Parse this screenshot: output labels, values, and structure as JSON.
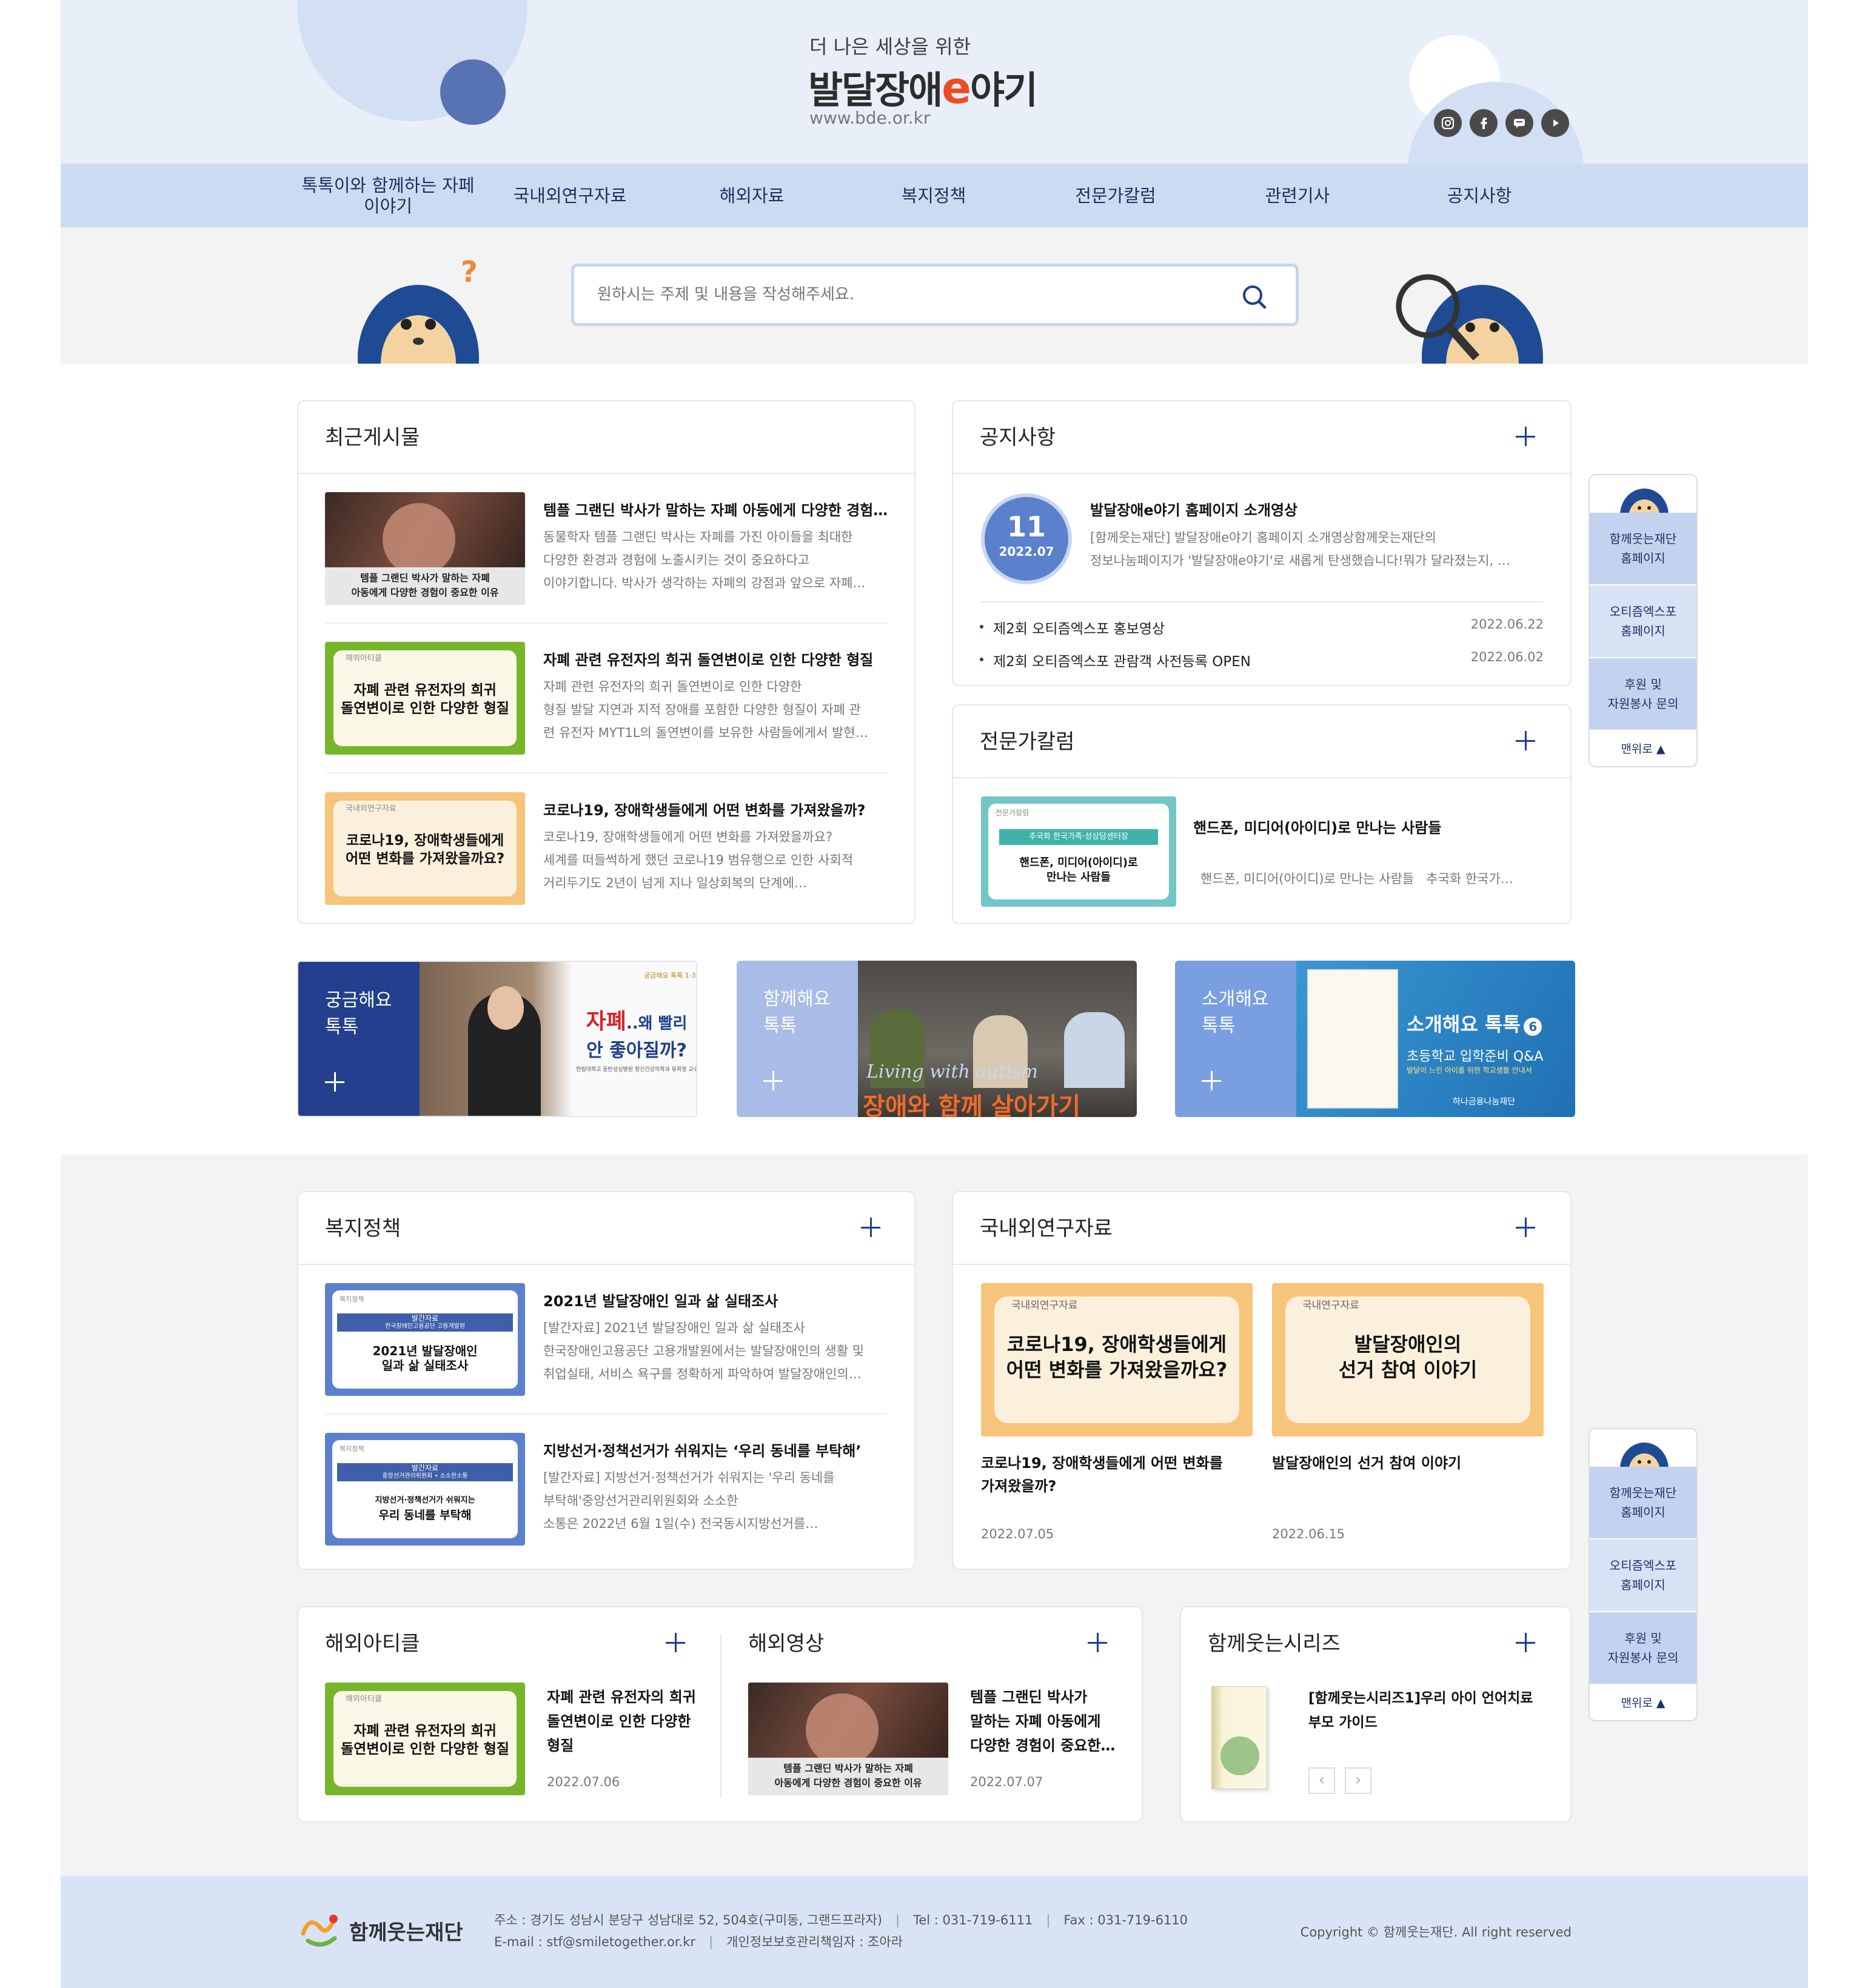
{
  "header": {
    "tagline": "더 나은 세상을 위한",
    "logo_a": "발달장애",
    "logo_e": "e",
    "logo_b": "야기",
    "url": "www.bde.or.kr"
  },
  "social": [
    "instagram-icon",
    "facebook-icon",
    "chat-icon",
    "youtube-icon"
  ],
  "nav": [
    "톡톡이와 함께하는 자페이야기",
    "국내외연구자료",
    "해외자료",
    "복지정책",
    "전문가칼럼",
    "관련기사",
    "공지사항"
  ],
  "search": {
    "placeholder": "원하시는 주제 및 내용을 작성해주세요."
  },
  "recent": {
    "title": "최근게시물",
    "items": [
      {
        "title": "템플 그랜딘 박사가 말하는 자폐 아동에게 다양한 경험…",
        "desc": [
          "동물학자 템플 그랜딘 박사는 자폐를 가진 아이들을 최대한",
          "다양한 환경과 경험에 노출시키는 것이 중요하다고",
          "이야기합니다. 박사가 생각하는 자폐의 강점과 앞으로 자폐…"
        ],
        "thumb_cap": [
          "템플 그랜딘 박사가 말하는 자폐",
          "아동에게 다양한 경험이 중요한 이유"
        ]
      },
      {
        "title": "자폐 관련 유전자의 희귀 돌연변이로 인한 다양한 형질",
        "desc": [
          "자폐 관련 유전자의 희귀 돌연변이로 인한 다양한",
          "형질 발달 지연과 지적 장애를 포함한 다양한 형질이 자폐 관",
          "련 유전자 MYT1L의 돌연변이를 보유한 사람들에게서 발현…"
        ],
        "thumb_tag": "해외아티클",
        "thumb_cap": [
          "자폐 관련 유전자의 희귀",
          "돌연변이로 인한 다양한 형질"
        ]
      },
      {
        "title": "코로나19, 장애학생들에게 어떤 변화를 가져왔을까?",
        "desc": [
          "코로나19, 장애학생들에게 어떤 변화를 가져왔을까요?",
          "세계를 떠들썩하게 했던 코로나19 범유행으로 인한 사회적",
          "거리두기도 2년이 넘게 지나 일상회복의 단계에…"
        ],
        "thumb_tag": "국내외연구자료",
        "thumb_cap": [
          "코로나19, 장애학생들에게",
          "어떤 변화를 가져왔을까요?"
        ]
      }
    ]
  },
  "notice": {
    "title": "공지사항",
    "day": "11",
    "ym": "2022.07",
    "featured_title": "발달장애e야기 홈페이지 소개영상",
    "featured_desc": [
      "[함께웃는재단] 발달장애e야기 홈페이지 소개영상함께웃는재단의",
      "정보나눔페이지가 '발달장애e야기'로 새롭게 탄생했습니다!뭐가 달라졌는지, …"
    ],
    "list": [
      {
        "text": "제2회 오티즘엑스포 홍보영상",
        "date": "2022.06.22"
      },
      {
        "text": "제2회 오티즘엑스포 관람객 사전등록 OPEN",
        "date": "2022.06.02"
      }
    ]
  },
  "column": {
    "title": "전문가칼럼",
    "item_title": "핸드폰, 미디어(아이디)로 만나는 사람들",
    "item_desc": "핸드폰, 미디어(아이디)로 만나는 사람들   추국화 한국가…",
    "thumb_tag": "전문가칼럼",
    "thumb_band": "추국화 한국가족·성상담센터장",
    "thumb_cap": [
      "핸드폰, 미디어(아이디)로",
      "만나는 사람들"
    ]
  },
  "banners": [
    {
      "l1": "궁금해요",
      "l2": "톡톡",
      "img_tag": "궁금해요 톡톡 1-3",
      "img_big1": "자폐",
      "img_mid": "..왜 빨리",
      "img_big2": "안 좋아질까?",
      "img_small": "한림대학교 동탄성심병원 정신건강의학과 유희정 교수"
    },
    {
      "l1": "함께해요",
      "l2": "톡톡",
      "img_script": "Living with autism",
      "img_big": "장애와 함께 살아가기"
    },
    {
      "l1": "소개해요",
      "l2": "톡톡",
      "img_title": "소개해요 톡톡",
      "img_num": "6",
      "img_sub": "초등학교 입학준비 Q&A",
      "img_sub2": "발달이 느린 아이를 위한 학교생활 안내서",
      "img_org": "하나금융나눔재단"
    }
  ],
  "welfare": {
    "title": "복지정책",
    "items": [
      {
        "title": "2021년 발달장애인 일과 삶 실태조사",
        "desc": [
          "[발간자료] 2021년 발달장애인 일과 삶 실태조사",
          "한국장애인고용공단 고용개발원에서는 발달장애인의 생활 및",
          "취업실태, 서비스 욕구를 정확하게 파악하여 발달장애인의…"
        ],
        "thumb_tag": "복지정책",
        "thumb_band": "발간자료",
        "thumb_band2": "한국장애인고용공단 고용개발원",
        "thumb_cap": [
          "2021년 발달장애인",
          "일과 삶 실태조사"
        ]
      },
      {
        "title": "지방선거·정책선거가 쉬워지는 ‘우리 동네를 부탁해’",
        "desc": [
          "[발간자료] 지방선거·정책선거가 쉬워지는 '우리 동네를",
          "부탁해'중앙선거관리위원회와 소소한",
          "소통은 2022년 6월 1일(수) 전국동시지방선거를…"
        ],
        "thumb_tag": "복지정책",
        "thumb_band": "발간자료",
        "thumb_band2": "중앙선거관리위원회 • 소소한소통",
        "thumb_cap": [
          "지방선거·정책선거가 쉬워지는",
          "우리 동네를 부탁해"
        ]
      }
    ]
  },
  "research": {
    "title": "국내외연구자료",
    "items": [
      {
        "tag": "국내외연구자료",
        "cap": [
          "코로나19, 장애학생들에게",
          "어떤 변화를 가져왔을까요?"
        ],
        "title": [
          "코로나19, 장애학생들에게 어떤 변화를",
          "가져왔을까?"
        ],
        "date": "2022.07.05"
      },
      {
        "tag": "국내연구자료",
        "cap": [
          "발달장애인의",
          "선거 참여 이야기"
        ],
        "title": [
          "발달장애인의 선거 참여 이야기"
        ],
        "date": "2022.06.15"
      }
    ]
  },
  "overseas_article": {
    "title": "해외아티클",
    "item_title": [
      "자폐 관련 유전자의 희귀",
      "돌연변이로 인한 다양한",
      "형질"
    ],
    "date": "2022.07.06",
    "thumb_tag": "해외아티클",
    "thumb_cap": [
      "자폐 관련 유전자의 희귀",
      "돌연변이로 인한 다양한 형질"
    ]
  },
  "overseas_video": {
    "title": "해외영상",
    "item_title": [
      "템플 그랜딘 박사가",
      "말하는 자폐 아동에게",
      "다양한 경험이 중요한…"
    ],
    "date": "2022.07.07",
    "thumb_cap": [
      "템플 그랜딘 박사가 말하는 자폐",
      "아동에게 다양한 경험이 중요한 이유"
    ]
  },
  "series": {
    "title": "함께웃는시리즈",
    "item_title": [
      "[함께웃는시리즈1]우리 아이 언어치료",
      "부모 가이드"
    ],
    "prev": "‹",
    "next": "›"
  },
  "quick": {
    "items": [
      [
        "함께웃는재단",
        "홈페이지"
      ],
      [
        "오티즘엑스포",
        "홈페이지"
      ],
      [
        "후원 및",
        "자원봉사 문의"
      ]
    ],
    "top": "맨위로 ▲"
  },
  "footer": {
    "org": "함께웃는재단",
    "addr": "주소 : 경기도 성남시 분당구 성남대로 52, 504호(구미동, 그랜드프라자)",
    "tel": "Tel : 031-719-6111",
    "fax": "Fax : 031-719-6110",
    "email": "E-mail : stf@smiletogether.or.kr",
    "privacy": "개인정보보호관리책임자 : 조아라",
    "copyright": "Copyright © 함께웃는재단. All right reserved"
  },
  "colors": {
    "navy": "#1f3f8a",
    "header_bg": "#e8eff9",
    "nav_bg": "#ccdbf1",
    "footer_bg": "#d8e3f5",
    "green": "#77b62b",
    "orange": "#f6c47a",
    "blue": "#5b81cd"
  }
}
